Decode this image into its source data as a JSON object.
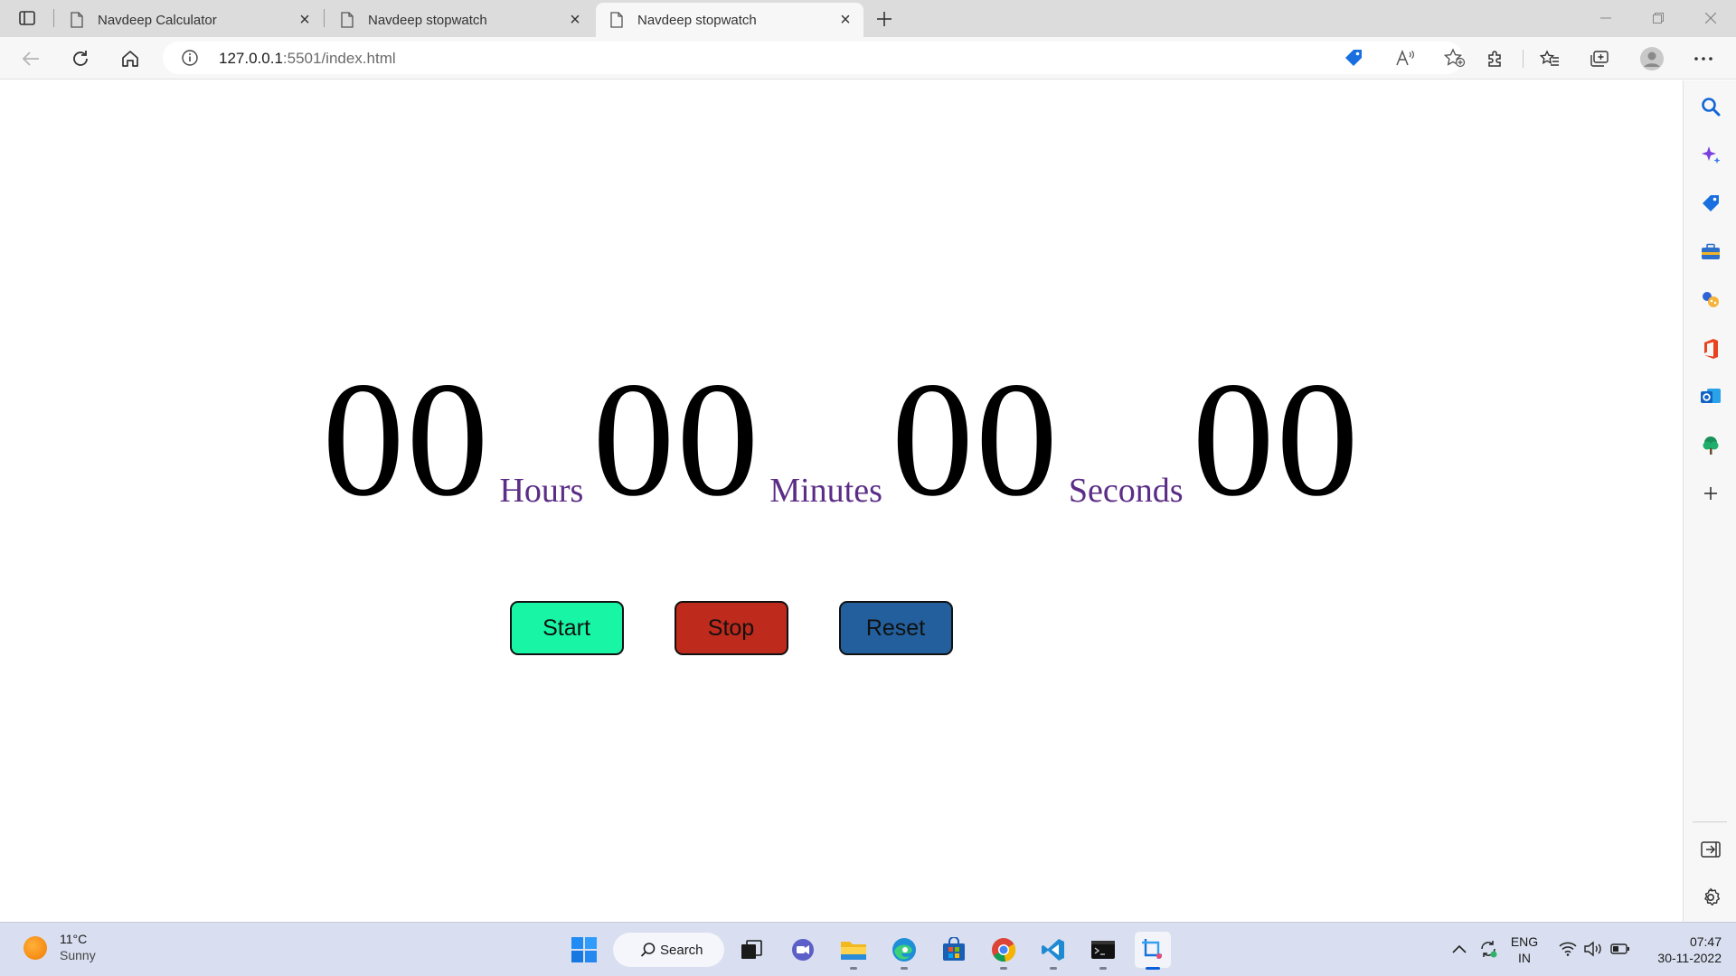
{
  "browser": {
    "tabs": [
      {
        "title": "Navdeep Calculator",
        "active": false
      },
      {
        "title": "Navdeep stopwatch",
        "active": false
      },
      {
        "title": "Navdeep stopwatch",
        "active": true
      }
    ],
    "url_host": "127.0.0.1",
    "url_rest": ":5501/index.html"
  },
  "stopwatch": {
    "hours": "00",
    "minutes": "00",
    "seconds": "00",
    "milliseconds": "00",
    "hours_label": "Hours",
    "minutes_label": "Minutes",
    "seconds_label": "Seconds",
    "buttons": {
      "start": "Start",
      "stop": "Stop",
      "reset": "Reset"
    },
    "colors": {
      "start": "#17f5a5",
      "stop": "#be2a1c",
      "reset": "#225f9c",
      "unit_label": "#5b2d86"
    }
  },
  "taskbar": {
    "weather_temp": "11°C",
    "weather_condition": "Sunny",
    "search_label": "Search",
    "language_primary": "ENG",
    "language_secondary": "IN",
    "time": "07:47",
    "date": "30-11-2022"
  }
}
